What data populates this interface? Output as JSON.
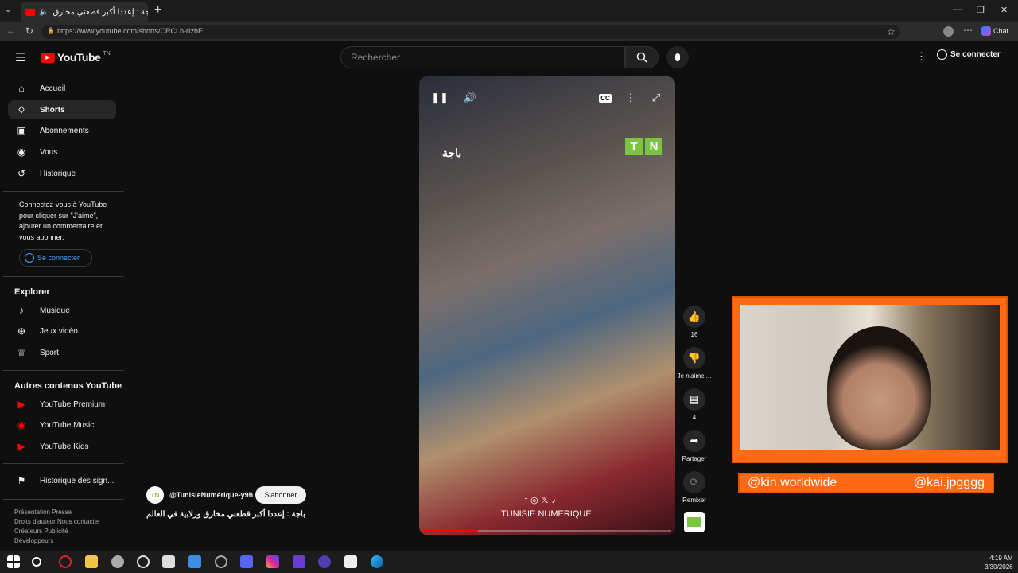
{
  "browser": {
    "tab_title": "باجة : إعددا أكبر قطعتي مخارق",
    "url": "https://www.youtube.com/shorts/CRCLh-rIzbE",
    "chat_label": "Chat"
  },
  "header": {
    "logo": "YouTube",
    "country": "TN",
    "search_placeholder": "Rechercher",
    "signin": "Se connecter"
  },
  "sidebar": {
    "items": [
      {
        "label": "Accueil",
        "icon": "home-icon"
      },
      {
        "label": "Shorts",
        "icon": "shorts-icon"
      },
      {
        "label": "Abonnements",
        "icon": "subscriptions-icon"
      },
      {
        "label": "Vous",
        "icon": "user-icon"
      },
      {
        "label": "Historique",
        "icon": "history-icon"
      }
    ],
    "connect_msg": "Connectez-vous à YouTube pour cliquer sur \"J'aime\", ajouter un commentaire et vous abonner.",
    "signin": "Se connecter",
    "explore_title": "Explorer",
    "explore": [
      {
        "label": "Musique",
        "icon": "music-icon"
      },
      {
        "label": "Jeux vidéo",
        "icon": "gaming-icon"
      },
      {
        "label": "Sport",
        "icon": "trophy-icon"
      }
    ],
    "more_title": "Autres contenus YouTube",
    "more": [
      {
        "label": "YouTube Premium"
      },
      {
        "label": "YouTube Music"
      },
      {
        "label": "YouTube Kids"
      }
    ],
    "report": "Historique des sign...",
    "footer": [
      "Présentation  Presse",
      "Droits d'auteur  Nous contacter",
      "Créateurs  Publicité",
      "Développeurs"
    ]
  },
  "video": {
    "overlay_text": "باجة",
    "tn_logo": [
      "T",
      "N"
    ],
    "social": "f◎𝕏♪",
    "brand": "TUNISIE NUMERIQUE",
    "progress": 0.22,
    "channel_avatar": "TN",
    "channel": "@TunisieNumérique-y9h",
    "subscribe": "S'abonner",
    "title": "باجة : إعددا أكبر  قطعتي مخارق وزلابية في العالم"
  },
  "actions": {
    "likes": "16",
    "dislike": "Je n'aime ...",
    "comments": "4",
    "share": "Partager",
    "remix": "Remixer"
  },
  "overlay": {
    "handle_left": "@kin.worldwide",
    "handle_right": "@kai.jpgggg"
  },
  "taskbar": {
    "time": "4:19 AM",
    "date": "3/30/2026"
  }
}
